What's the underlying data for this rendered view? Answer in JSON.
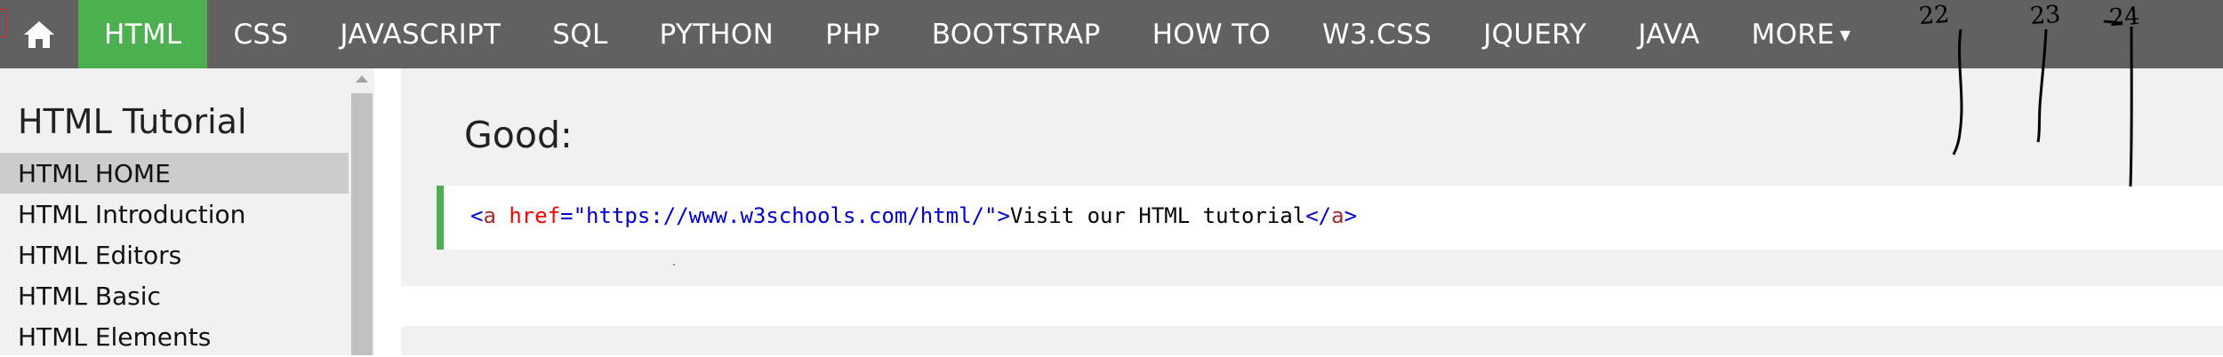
{
  "topnav": {
    "items": [
      {
        "label": "HTML",
        "active": true
      },
      {
        "label": "CSS"
      },
      {
        "label": "JAVASCRIPT"
      },
      {
        "label": "SQL"
      },
      {
        "label": "PYTHON"
      },
      {
        "label": "PHP"
      },
      {
        "label": "BOOTSTRAP"
      },
      {
        "label": "HOW TO"
      },
      {
        "label": "W3.CSS"
      },
      {
        "label": "JQUERY"
      },
      {
        "label": "JAVA"
      },
      {
        "label": "MORE",
        "caret": "▾"
      }
    ],
    "home_icon": "home-icon",
    "colors": {
      "bar": "#616161",
      "active": "#4caf50",
      "text": "#ffffff"
    }
  },
  "sidebar": {
    "title": "HTML Tutorial",
    "items": [
      {
        "label": "HTML HOME",
        "active": true
      },
      {
        "label": "HTML Introduction"
      },
      {
        "label": "HTML Editors"
      },
      {
        "label": "HTML Basic"
      },
      {
        "label": "HTML Elements"
      }
    ]
  },
  "main": {
    "heading": "Good:",
    "code": {
      "open_bracket": "<",
      "tag": "a",
      "attr": "href",
      "equals": "=",
      "value": "\"https://www.w3schools.com/html/\"",
      "close_bracket": ">",
      "text": "Visit our HTML tutorial",
      "end_open": "</",
      "end_tag": "a",
      "end_close": ">"
    },
    "accent": "#4caf50"
  },
  "annotations": {
    "labels": [
      "22",
      "23",
      "24"
    ]
  }
}
